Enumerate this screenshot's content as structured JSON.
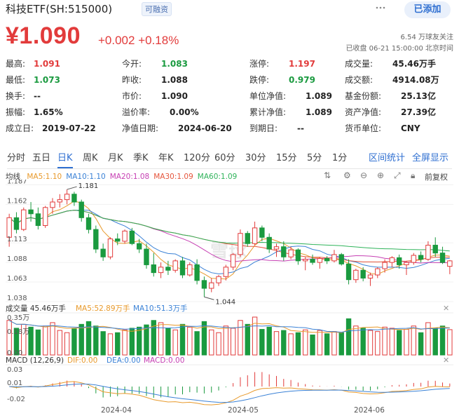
{
  "header": {
    "title": "科技ETF(SH:515000)",
    "badge": "可融资",
    "add_button": "已添加"
  },
  "quote": {
    "price": "¥1.090",
    "change": "+0.002 +0.18%",
    "followers": "6.54 万球友关注",
    "status": "已收盘 06-21 15:00:00 北京时间"
  },
  "stats": [
    [
      {
        "k": "最高:",
        "v": "1.091",
        "c": "red"
      },
      {
        "k": "今开:",
        "v": "1.083",
        "c": "green"
      },
      {
        "k": "涨停:",
        "v": "1.197",
        "c": "red"
      },
      {
        "k": "成交量:",
        "v": "45.46万手",
        "c": ""
      }
    ],
    [
      {
        "k": "最低:",
        "v": "1.073",
        "c": "green"
      },
      {
        "k": "昨收:",
        "v": "1.088",
        "c": ""
      },
      {
        "k": "跌停:",
        "v": "0.979",
        "c": "green"
      },
      {
        "k": "成交额:",
        "v": "4914.08万",
        "c": ""
      }
    ],
    [
      {
        "k": "换手:",
        "v": "--",
        "c": ""
      },
      {
        "k": "市价:",
        "v": "1.090",
        "c": ""
      },
      {
        "k": "单位净值:",
        "v": "1.089",
        "c": ""
      },
      {
        "k": "基金份额:",
        "v": "25.13亿",
        "c": ""
      }
    ],
    [
      {
        "k": "振幅:",
        "v": "1.65%",
        "c": ""
      },
      {
        "k": "溢价率:",
        "v": "0.00%",
        "c": ""
      },
      {
        "k": "累计净值:",
        "v": "1.089",
        "c": ""
      },
      {
        "k": "资产净值:",
        "v": "27.39亿",
        "c": ""
      }
    ],
    [
      {
        "k": "成立日:",
        "v": "2019-07-22",
        "c": ""
      },
      {
        "k": "净值日期:",
        "v": "2024-06-20",
        "c": ""
      },
      {
        "k": "到期日:",
        "v": "--",
        "c": ""
      },
      {
        "k": "货币单位:",
        "v": "CNY",
        "c": ""
      }
    ]
  ],
  "tabs": [
    "分时",
    "五日",
    "日K",
    "周K",
    "月K",
    "季K",
    "年K",
    "120分",
    "60分",
    "30分",
    "15分",
    "5分",
    "1分"
  ],
  "active_tab": "日K",
  "tab_actions": [
    "区间统计",
    "全屏显示"
  ],
  "price_chart": {
    "label": "均线",
    "ma": [
      {
        "text": "MA5:1.10",
        "color": "#e89a2c"
      },
      {
        "text": "MA10:1.10",
        "color": "#3b82d6"
      },
      {
        "text": "MA20:1.08",
        "color": "#c63fb3"
      },
      {
        "text": "MA30:1.09",
        "color": "#e5553c"
      },
      {
        "text": "MA60:1.09",
        "color": "#2fb35a"
      }
    ],
    "fq": "前复权",
    "y_ticks": [
      "1.187",
      "1.162",
      "1.113",
      "1.088",
      "1.063",
      "1.038"
    ],
    "high_label": "1.181",
    "low_label": "1.044",
    "watermark": "雪球"
  },
  "volume_chart": {
    "label": "成交量 45.46万手",
    "ma5": "MA5:52.89万手",
    "ma10": "MA10:51.3万手",
    "y_ticks": [
      "0.35万",
      "0.18万",
      "0.00"
    ]
  },
  "macd_chart": {
    "label": "MACD (12,26,9)",
    "dif": "DIF:0.00",
    "dea": "DEA:0.00",
    "macd": "MACD:0.00",
    "y_ticks": [
      "0.03",
      "0.01",
      "-0.02"
    ]
  },
  "x_axis": [
    "2024-04",
    "2024-05",
    "2024-06"
  ],
  "colors": {
    "up": "#e23b3b",
    "down": "#1a9a3f",
    "accent": "#2f6fd1"
  },
  "chart_data": {
    "type": "candlestick",
    "title": "",
    "ylim": [
      1.038,
      1.19
    ],
    "ohlc": [
      [
        1.12,
        1.15,
        1.108,
        1.145
      ],
      [
        1.145,
        1.152,
        1.125,
        1.13
      ],
      [
        1.13,
        1.158,
        1.128,
        1.155
      ],
      [
        1.155,
        1.165,
        1.14,
        1.15
      ],
      [
        1.15,
        1.158,
        1.13,
        1.135
      ],
      [
        1.135,
        1.16,
        1.132,
        1.158
      ],
      [
        1.158,
        1.17,
        1.15,
        1.165
      ],
      [
        1.165,
        1.175,
        1.158,
        1.168
      ],
      [
        1.168,
        1.181,
        1.162,
        1.175
      ],
      [
        1.175,
        1.178,
        1.16,
        1.165
      ],
      [
        1.165,
        1.168,
        1.14,
        1.145
      ],
      [
        1.145,
        1.15,
        1.125,
        1.13
      ],
      [
        1.13,
        1.135,
        1.1,
        1.105
      ],
      [
        1.105,
        1.112,
        1.09,
        1.095
      ],
      [
        1.095,
        1.12,
        1.092,
        1.118
      ],
      [
        1.118,
        1.125,
        1.11,
        1.115
      ],
      [
        1.115,
        1.13,
        1.112,
        1.128
      ],
      [
        1.128,
        1.132,
        1.11,
        1.112
      ],
      [
        1.112,
        1.118,
        1.1,
        1.105
      ],
      [
        1.105,
        1.112,
        1.08,
        1.085
      ],
      [
        1.085,
        1.1,
        1.07,
        1.075
      ],
      [
        1.075,
        1.088,
        1.068,
        1.082
      ],
      [
        1.082,
        1.09,
        1.072,
        1.078
      ],
      [
        1.078,
        1.092,
        1.075,
        1.09
      ],
      [
        1.09,
        1.095,
        1.068,
        1.072
      ],
      [
        1.072,
        1.088,
        1.07,
        1.085
      ],
      [
        1.085,
        1.092,
        1.06,
        1.065
      ],
      [
        1.065,
        1.07,
        1.044,
        1.055
      ],
      [
        1.055,
        1.068,
        1.05,
        1.062
      ],
      [
        1.062,
        1.072,
        1.058,
        1.07
      ],
      [
        1.07,
        1.085,
        1.065,
        1.082
      ],
      [
        1.082,
        1.1,
        1.078,
        1.098
      ],
      [
        1.098,
        1.13,
        1.095,
        1.125
      ],
      [
        1.125,
        1.128,
        1.108,
        1.112
      ],
      [
        1.112,
        1.14,
        1.11,
        1.132
      ],
      [
        1.132,
        1.135,
        1.115,
        1.12
      ],
      [
        1.12,
        1.125,
        1.1,
        1.105
      ],
      [
        1.105,
        1.112,
        1.095,
        1.108
      ],
      [
        1.108,
        1.115,
        1.09,
        1.095
      ],
      [
        1.095,
        1.108,
        1.092,
        1.104
      ],
      [
        1.104,
        1.106,
        1.085,
        1.09
      ],
      [
        1.09,
        1.095,
        1.078,
        1.092
      ],
      [
        1.092,
        1.098,
        1.085,
        1.088
      ],
      [
        1.088,
        1.095,
        1.08,
        1.093
      ],
      [
        1.093,
        1.096,
        1.086,
        1.09
      ],
      [
        1.09,
        1.104,
        1.088,
        1.098
      ],
      [
        1.098,
        1.1,
        1.084,
        1.086
      ],
      [
        1.086,
        1.092,
        1.06,
        1.066
      ],
      [
        1.066,
        1.08,
        1.062,
        1.078
      ],
      [
        1.078,
        1.082,
        1.064,
        1.068
      ],
      [
        1.068,
        1.075,
        1.058,
        1.072
      ],
      [
        1.072,
        1.082,
        1.068,
        1.08
      ],
      [
        1.08,
        1.092,
        1.075,
        1.088
      ],
      [
        1.088,
        1.096,
        1.082,
        1.094
      ],
      [
        1.094,
        1.098,
        1.08,
        1.085
      ],
      [
        1.085,
        1.09,
        1.072,
        1.088
      ],
      [
        1.088,
        1.1,
        1.085,
        1.097
      ],
      [
        1.097,
        1.102,
        1.088,
        1.092
      ],
      [
        1.092,
        1.115,
        1.09,
        1.11
      ],
      [
        1.11,
        1.12,
        1.095,
        1.1
      ],
      [
        1.1,
        1.108,
        1.086,
        1.088
      ],
      [
        1.083,
        1.091,
        1.073,
        1.09
      ]
    ],
    "volume": [
      62,
      48,
      55,
      50,
      45,
      52,
      58,
      44,
      40,
      47,
      55,
      60,
      52,
      42,
      38,
      40,
      45,
      48,
      50,
      54,
      62,
      58,
      48,
      45,
      55,
      50,
      42,
      60,
      45,
      40,
      52,
      48,
      62,
      55,
      68,
      46,
      50,
      42,
      44,
      38,
      40,
      45,
      36,
      44,
      38,
      42,
      40,
      65,
      52,
      48,
      44,
      42,
      50,
      48,
      44,
      46,
      52,
      40,
      58,
      48,
      52,
      45.46
    ],
    "dates_axis": [
      "2024-04",
      "2024-05",
      "2024-06"
    ]
  }
}
